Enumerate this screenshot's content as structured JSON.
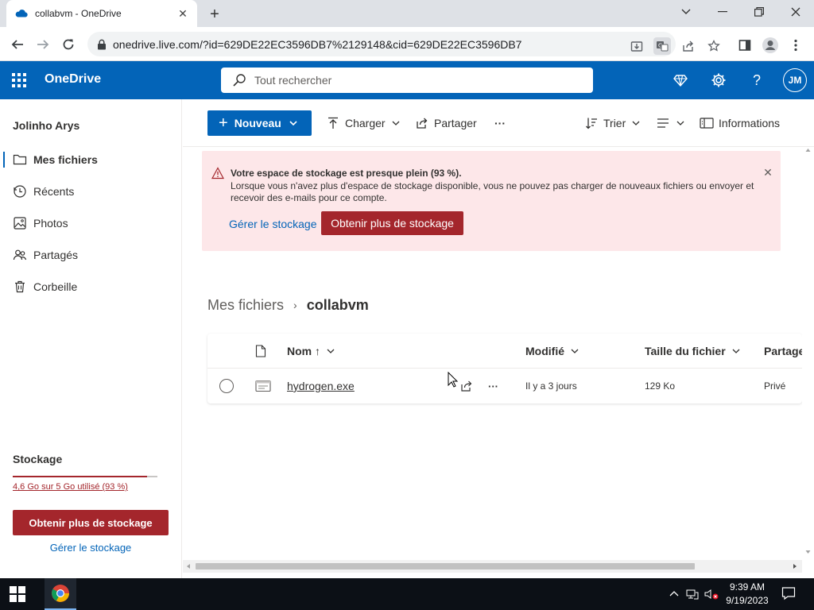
{
  "browser": {
    "tab_title": "collabvm - OneDrive",
    "url": "onedrive.live.com/?id=629DE22EC3596DB7%2129148&cid=629DE22EC3596DB7"
  },
  "header": {
    "brand": "OneDrive",
    "search_placeholder": "Tout rechercher",
    "avatar_initials": "JM"
  },
  "sidebar": {
    "user_name": "Jolinho Arys",
    "items": [
      {
        "label": "Mes fichiers",
        "icon": "folder-icon",
        "active": true
      },
      {
        "label": "Récents",
        "icon": "clock-icon",
        "active": false
      },
      {
        "label": "Photos",
        "icon": "photo-icon",
        "active": false
      },
      {
        "label": "Partagés",
        "icon": "people-icon",
        "active": false
      },
      {
        "label": "Corbeille",
        "icon": "trash-icon",
        "active": false
      }
    ],
    "storage_title": "Stockage",
    "storage_text": "4,6 Go sur 5 Go utilisé (93 %)",
    "storage_fraction": 0.93,
    "get_more_label": "Obtenir plus de stockage",
    "manage_label": "Gérer le stockage"
  },
  "commandbar": {
    "new_label": "Nouveau",
    "upload_label": "Charger",
    "share_label": "Partager",
    "more_label": "···",
    "sort_label": "Trier",
    "info_label": "Informations"
  },
  "alert": {
    "title": "Votre espace de stockage est presque plein (93 %).",
    "body": "Lorsque vous n'avez plus d'espace de stockage disponible, vous ne pouvez pas charger de nouveaux fichiers ou envoyer et recevoir des e-mails pour ce compte.",
    "manage_label": "Gérer le stockage",
    "get_more_label": "Obtenir plus de stockage"
  },
  "breadcrumb": {
    "parent": "Mes fichiers",
    "separator": "›",
    "current": "collabvm"
  },
  "filelist": {
    "columns": {
      "name": "Nom ↑",
      "modified": "Modifié",
      "size": "Taille du fichier",
      "sharing": "Partage"
    },
    "rows": [
      {
        "name": "hydrogen.exe",
        "modified": "Il y a 3 jours",
        "size": "129 Ko",
        "sharing": "Privé",
        "more": "···"
      }
    ]
  },
  "taskbar": {
    "time": "9:39 AM",
    "date": "9/19/2023"
  },
  "colors": {
    "brand_blue": "#0364b8",
    "alert_red": "#a4262c",
    "alert_bg": "#fde7e9"
  }
}
